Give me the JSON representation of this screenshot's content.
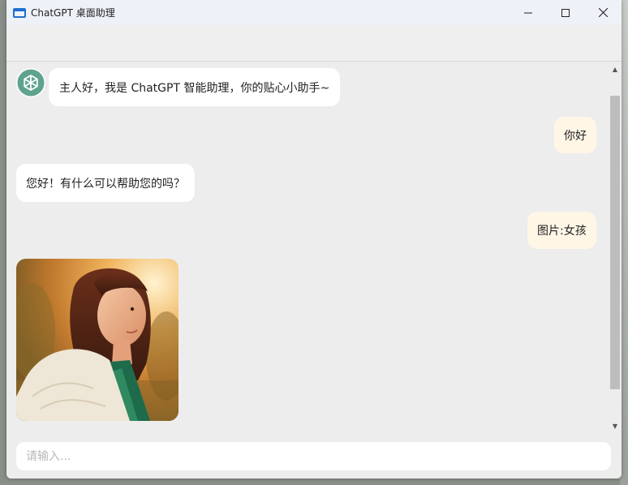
{
  "window": {
    "title": "ChatGPT 桌面助理",
    "minimize_glyph": "—",
    "maximize_glyph": "☐",
    "close_glyph": "✕"
  },
  "messages": [
    {
      "role": "assistant",
      "text": "主人好，我是 ChatGPT 智能助理，你的贴心小助手~"
    },
    {
      "role": "user",
      "text": "你好"
    },
    {
      "role": "assistant",
      "text": "您好！有什么可以帮助您的吗？"
    },
    {
      "role": "user",
      "text": "图片:女孩"
    },
    {
      "role": "assistant",
      "type": "image",
      "image_alt": "girl photo"
    }
  ],
  "input": {
    "placeholder": "请输入...",
    "value": ""
  },
  "colors": {
    "user_bubble": "#fff6e6",
    "bot_bubble": "#ffffff",
    "chat_bg": "#ededed",
    "avatar_logo": "#5fa38f"
  }
}
